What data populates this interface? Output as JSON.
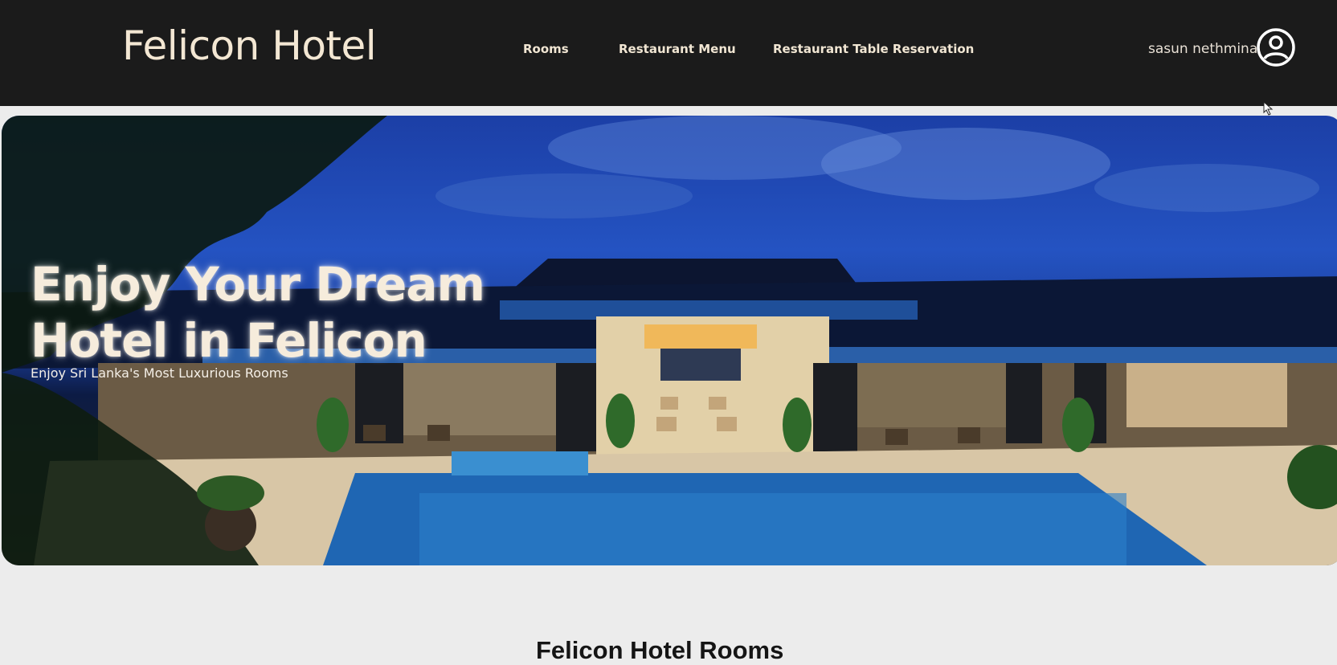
{
  "header": {
    "brand": "Felicon Hotel",
    "nav": [
      "Rooms",
      "Restaurant Menu",
      "Restaurant Table Reservation"
    ],
    "user_name": "sasun nethmina",
    "user_icon": "user-circle-icon"
  },
  "hero": {
    "title_line1": "Enjoy Your Dream",
    "title_line2": "Hotel in Felicon",
    "subtitle": "Enjoy Sri Lanka's Most Luxurious Rooms"
  },
  "rooms_section": {
    "title": "Felicon Hotel Rooms"
  },
  "colors": {
    "navbar": "#1b1b1b",
    "brand_text": "#f3e7d3",
    "page_bg": "#ececec"
  }
}
